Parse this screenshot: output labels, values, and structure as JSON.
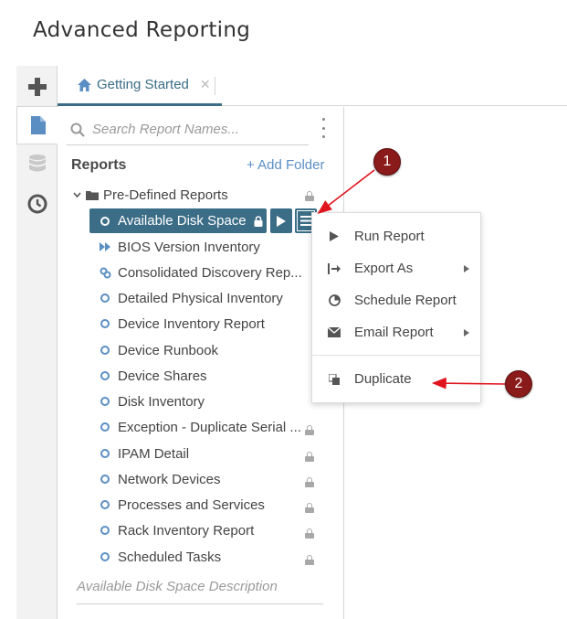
{
  "page": {
    "title": "Advanced Reporting"
  },
  "tab": {
    "label": "Getting Started",
    "close": "✕"
  },
  "search": {
    "placeholder": "Search Report Names..."
  },
  "reports": {
    "heading": "Reports",
    "add_folder": "+ Add Folder",
    "folder": "Pre-Defined Reports",
    "selected": "Available Disk Space",
    "items": [
      "BIOS Version Inventory",
      "Consolidated Discovery Rep...",
      "Detailed Physical Inventory",
      "Device Inventory Report",
      "Device Runbook",
      "Device Shares",
      "Disk Inventory",
      "Exception - Duplicate Serial ...",
      "IPAM Detail",
      "Network Devices",
      "Processes and Services",
      "Rack Inventory Report",
      "Scheduled Tasks"
    ],
    "description": "Available Disk Space Description"
  },
  "context_menu": {
    "run": "Run Report",
    "export": "Export As",
    "schedule": "Schedule Report",
    "email": "Email Report",
    "duplicate": "Duplicate"
  },
  "callouts": {
    "first": "1",
    "second": "2"
  },
  "colors": {
    "accent": "#3b6d86",
    "link": "#5b8fc4",
    "annotation": "#8b1a1a",
    "arrow": "#e0141e"
  }
}
